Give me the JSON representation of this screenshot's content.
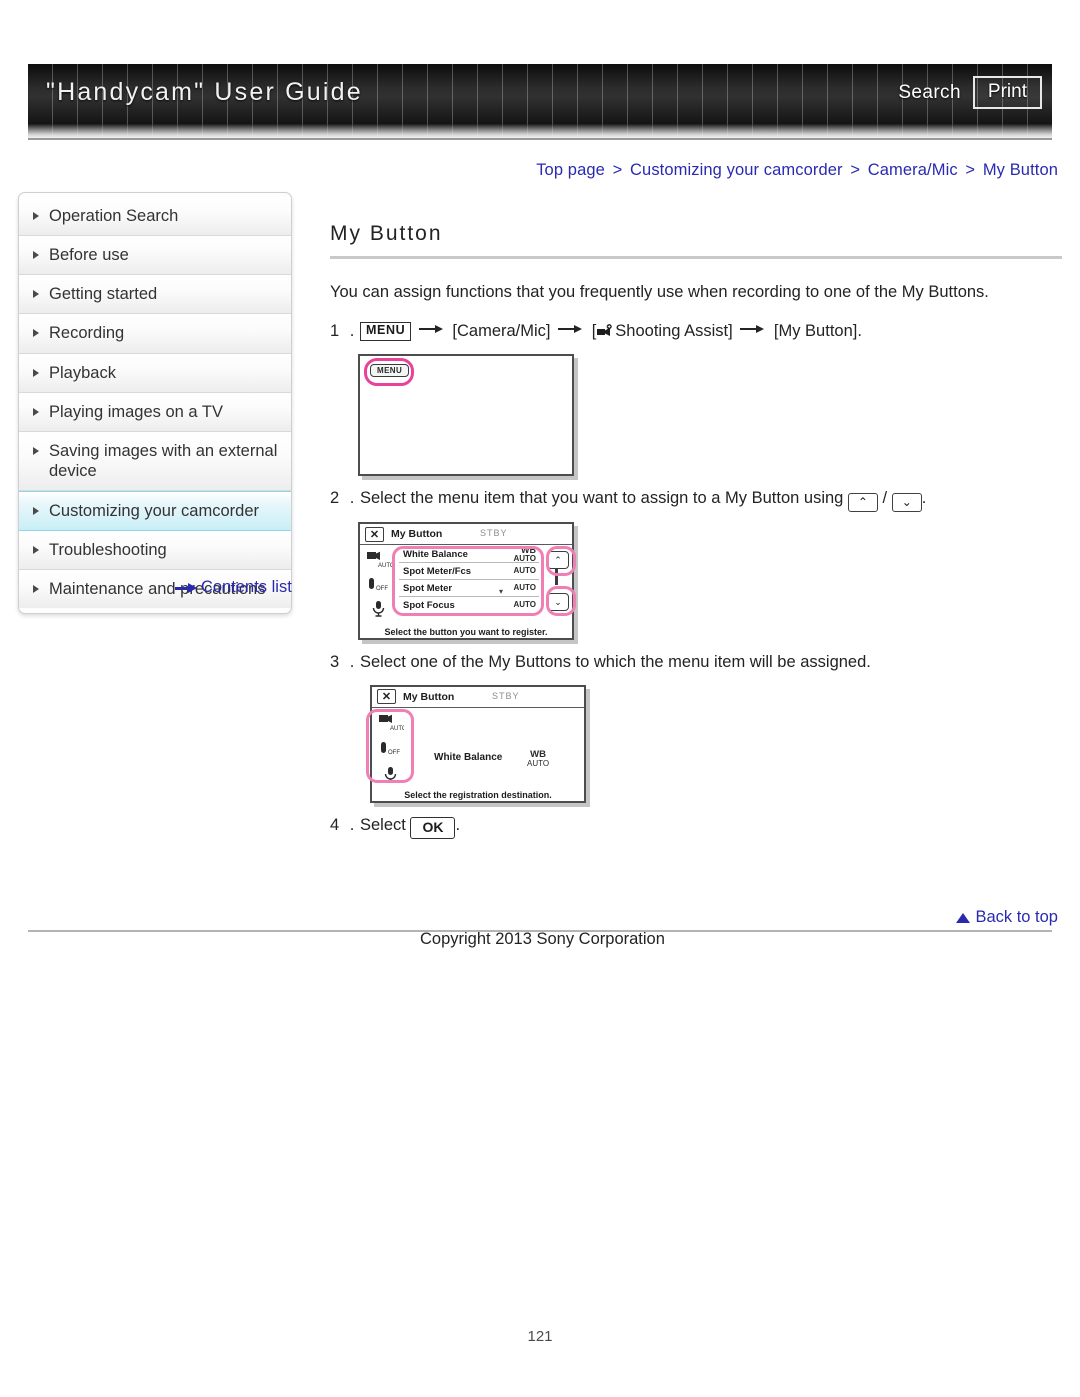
{
  "header": {
    "site_title": "\"Handycam\" User Guide",
    "search_label": "Search",
    "print_label": "Print"
  },
  "breadcrumb": {
    "items": [
      "Top page",
      "Customizing your camcorder",
      "Camera/Mic",
      "My Button"
    ],
    "separator": ">"
  },
  "sidebar": {
    "items": [
      {
        "label": "Operation Search",
        "active": false
      },
      {
        "label": "Before use",
        "active": false
      },
      {
        "label": "Getting started",
        "active": false
      },
      {
        "label": "Recording",
        "active": false
      },
      {
        "label": "Playback",
        "active": false
      },
      {
        "label": "Playing images on a TV",
        "active": false
      },
      {
        "label": "Saving images with an external device",
        "active": false
      },
      {
        "label": "Customizing your camcorder",
        "active": true
      },
      {
        "label": "Troubleshooting",
        "active": false
      },
      {
        "label": "Maintenance and precautions",
        "active": false
      }
    ],
    "contents_list_label": "Contents list"
  },
  "main": {
    "title": "My Button",
    "lead": "You can assign functions that you frequently use when recording to one of the My Buttons.",
    "steps": [
      {
        "num": "1 .",
        "menu_chip": "MENU",
        "parts": [
          "[Camera/Mic]",
          "[",
          "Shooting Assist]",
          "[My Button]."
        ]
      },
      {
        "num": "2 .",
        "text_before": "Select the menu item that you want to assign to a My Button using",
        "key_up": "⌃",
        "key_sep": "/",
        "key_down": "⌄",
        "text_after": "."
      },
      {
        "num": "3 .",
        "text": "Select one of the My Buttons to which the menu item will be assigned."
      },
      {
        "num": "4 .",
        "text_before": "Select",
        "ok_chip": "OK",
        "text_after": "."
      }
    ],
    "figure1": {
      "menu_button_label": "MENU"
    },
    "figure2": {
      "title": "My Button",
      "close_label": "✕",
      "status": "STBY",
      "rows": [
        {
          "name": "White Balance",
          "value_top": "WB",
          "value_bottom": "AUTO"
        },
        {
          "name": "Spot Meter/Fcs",
          "value_top": "",
          "value_bottom": "AUTO"
        },
        {
          "name": "Spot Meter",
          "value_top": "",
          "value_bottom": "AUTO"
        },
        {
          "name": "Spot Focus",
          "value_top": "",
          "value_bottom": "AUTO"
        }
      ],
      "caption": "Select the button you want to register.",
      "nav_up": "⌃",
      "nav_down": "⌄"
    },
    "figure3": {
      "title": "My Button",
      "close_label": "✕",
      "status": "STBY",
      "assigned_label": "White Balance",
      "assigned_value_top": "WB",
      "assigned_value_bottom": "AUTO",
      "caption": "Select the registration destination."
    }
  },
  "footer": {
    "back_to_top": "Back to top",
    "copyright": "Copyright 2013 Sony Corporation",
    "page_number": "121"
  },
  "colors": {
    "link": "#2a2ab0",
    "accent_highlight": "#e8429a",
    "accent_highlight_soft": "#ef7fb4",
    "active_nav": "#c9eef6",
    "header_dark": "#1b1b1b"
  }
}
